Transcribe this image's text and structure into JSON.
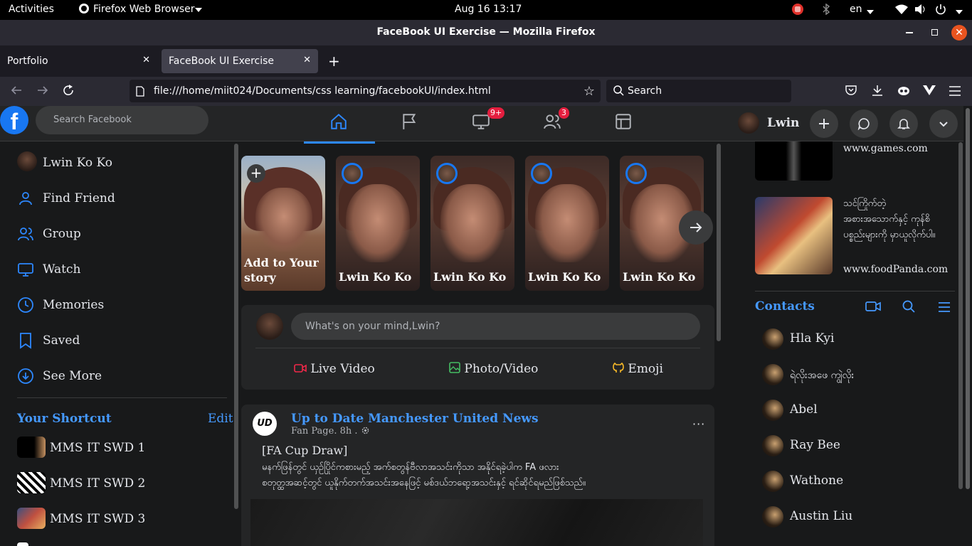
{
  "os": {
    "activities": "Activities",
    "app_menu": "Firefox Web Browser",
    "clock": "Aug 16  13:17",
    "lang": "en"
  },
  "window": {
    "title": "FaceBook UI Exercise — Mozilla Firefox"
  },
  "tabs": [
    {
      "label": "Portfolio"
    },
    {
      "label": "FaceBook UI Exercise"
    }
  ],
  "navbar": {
    "url": "file:///home/miit024/Documents/css learning/facebookUI/index.html",
    "search_placeholder": "Search"
  },
  "fb_header": {
    "logo": "f",
    "search_placeholder": "Search Facebook",
    "watch_badge": "9+",
    "friends_badge": "3",
    "user_name": "Lwin"
  },
  "sidebar": {
    "profile_name": "Lwin Ko Ko",
    "items": [
      {
        "label": "Find Friend",
        "icon": "user-icon"
      },
      {
        "label": "Group",
        "icon": "users-icon"
      },
      {
        "label": "Watch",
        "icon": "monitor-icon"
      },
      {
        "label": "Memories",
        "icon": "clock-icon"
      },
      {
        "label": "Saved",
        "icon": "bookmark-icon"
      },
      {
        "label": "See More",
        "icon": "chevron-down-circle-icon"
      }
    ],
    "shortcut_title": "Your Shortcut",
    "shortcut_edit": "Edit",
    "shortcuts": [
      {
        "label": "MMS IT SWD 1"
      },
      {
        "label": "MMS IT SWD 2"
      },
      {
        "label": "MMS IT SWD 3"
      }
    ]
  },
  "stories": {
    "add_label": "Add to Your story",
    "items": [
      {
        "name": "Lwin Ko Ko"
      },
      {
        "name": "Lwin Ko Ko"
      },
      {
        "name": "Lwin Ko Ko"
      },
      {
        "name": "Lwin Ko Ko"
      }
    ]
  },
  "composer": {
    "placeholder": "What's on your mind,Lwin?",
    "live": "Live Video",
    "photo": "Photo/Video",
    "emoji": "Emoji"
  },
  "post": {
    "page_name": "Up to Date Manchester United News",
    "meta": "Fan Page. 8h .",
    "title": "[FA Cup Draw]",
    "line1": "မနက်ဖြန်တွင် ယှဉ်ပြိုင်ကစားမည့် အက်စတွန်ဗီလာအသင်းကိုသာ အနိုင်ရခဲ့ပါက FA ဖလား",
    "line2": "စတုတ္ထအဆင့်တွင် ယူနိုက်တက်အသင်းအနေဖြင့် မစ်ဒယ်ဘရော့အသင်းနှင့် ရင်ဆိုင်ရမည်ဖြစ်သည်။"
  },
  "sponsored": [
    {
      "text": "www.games.com"
    },
    {
      "text": "သင်ကြိုက်တဲ့ အစားအသောက်နှင့် ကုန်စိပစ္စည်းများကို မှာယူလိုက်ပါ။",
      "link": "www.foodPanda.com"
    }
  ],
  "contacts": {
    "title": "Contacts",
    "items": [
      {
        "name": "Hla Kyi"
      },
      {
        "name": "ရဲလိုးအဖေ ကျွဲလိုး"
      },
      {
        "name": "Abel"
      },
      {
        "name": "Ray Bee"
      },
      {
        "name": "Wathone"
      },
      {
        "name": "Austin Liu"
      }
    ]
  },
  "colors": {
    "fb_blue": "#1877f2",
    "bg": "#18191a",
    "card": "#242526",
    "badge_red": "#e41e3f"
  }
}
